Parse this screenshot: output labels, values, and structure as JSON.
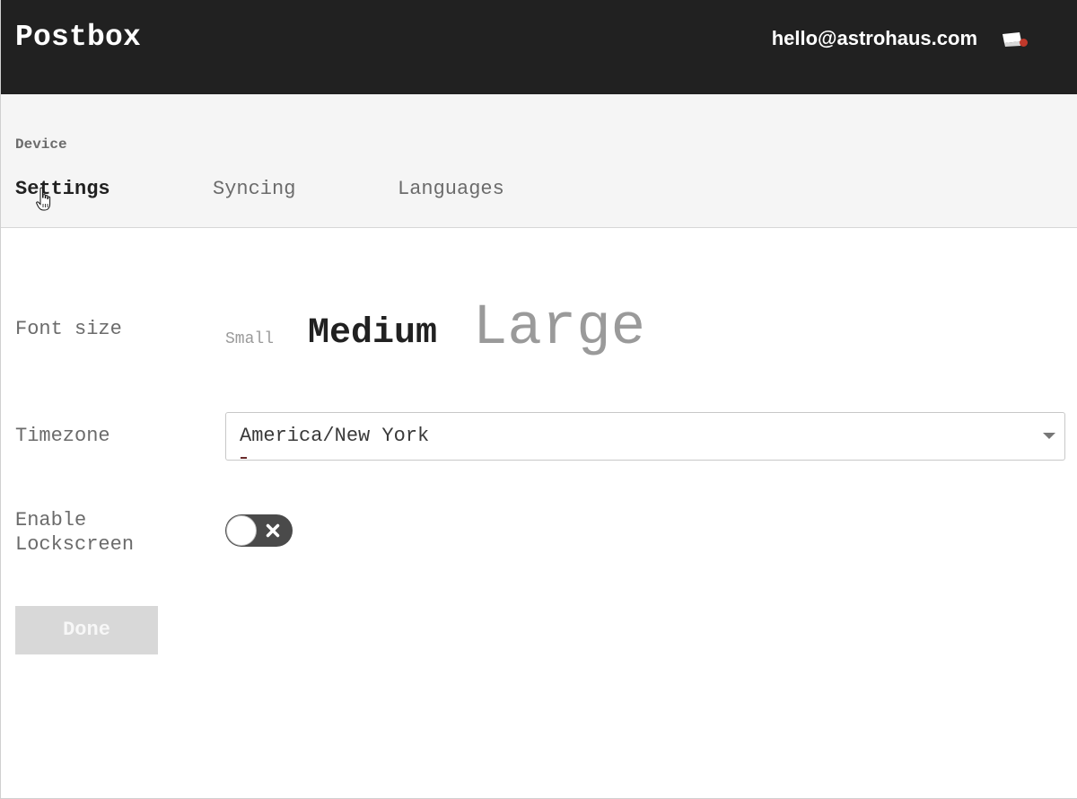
{
  "app": {
    "title": "Postbox"
  },
  "header": {
    "account_email": "hello@astrohaus.com",
    "inbox_icon": "inbox-tray-icon",
    "notification_dot_color": "#c0392b"
  },
  "subheader": {
    "section_label": "Device",
    "tabs": [
      {
        "label": "Settings",
        "active": true
      },
      {
        "label": "Syncing",
        "active": false
      },
      {
        "label": "Languages",
        "active": false
      }
    ]
  },
  "form": {
    "font_size": {
      "label": "Font size",
      "options": [
        {
          "label": "Small",
          "selected": false
        },
        {
          "label": "Medium",
          "selected": true
        },
        {
          "label": "Large",
          "selected": false
        }
      ]
    },
    "timezone": {
      "label": "Timezone",
      "value": "America/New York",
      "caret_icon": "caret-down-icon"
    },
    "lockscreen": {
      "label": "Enable Lockscreen",
      "enabled": false,
      "off_icon": "x-icon"
    },
    "done": {
      "label": "Done",
      "disabled": true
    }
  },
  "colors": {
    "topbar": "#212121",
    "subheader": "#f5f5f5",
    "text_active": "#212121",
    "text_muted": "#6b6b6b",
    "button_disabled": "#d8d8d8"
  }
}
